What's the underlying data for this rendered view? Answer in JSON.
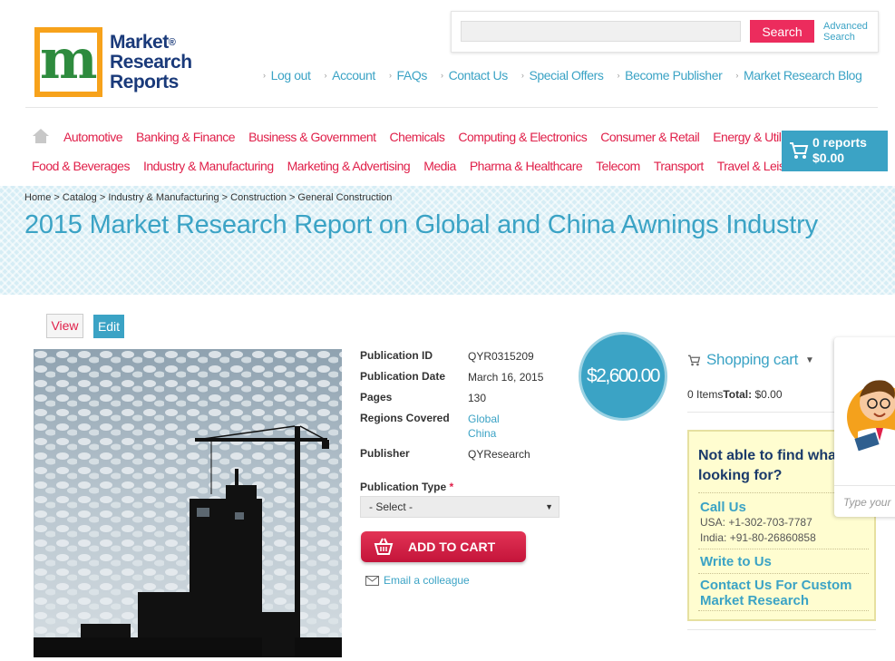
{
  "brand": {
    "logo_letter": "m",
    "line1": "Market",
    "line2": "Research",
    "line3": "Reports",
    "reg": "®"
  },
  "search": {
    "placeholder": "",
    "button": "Search",
    "advanced": "Advanced Search"
  },
  "top_links": [
    "Log out",
    "Account",
    "FAQs",
    "Contact Us",
    "Special Offers",
    "Become Publisher",
    "Market Research Blog"
  ],
  "nav_row1": [
    "Automotive",
    "Banking & Finance",
    "Business & Government",
    "Chemicals",
    "Computing & Electronics",
    "Consumer & Retail",
    "Energy & Utilities"
  ],
  "nav_row2": [
    "Food & Beverages",
    "Industry & Manufacturing",
    "Marketing & Advertising",
    "Media",
    "Pharma & Healthcare",
    "Telecom",
    "Transport",
    "Travel & Leisure"
  ],
  "cart_button": {
    "count": "0 reports",
    "total": "$0.00"
  },
  "breadcrumb": "Home > Catalog > Industry & Manufacturing > Construction > General Construction",
  "title": "2015 Market Research Report on Global and China Awnings Industry",
  "tabs": {
    "view": "View",
    "edit": "Edit"
  },
  "details": {
    "pub_id_label": "Publication ID",
    "pub_id": "QYR0315209",
    "pub_date_label": "Publication Date",
    "pub_date": "March 16, 2015",
    "pages_label": "Pages",
    "pages": "130",
    "regions_label": "Regions Covered",
    "region1": "Global",
    "region2": "China",
    "publisher_label": "Publisher",
    "publisher": "QYResearch"
  },
  "pub_type": {
    "label": "Publication Type",
    "required": "*",
    "selected": "- Select -"
  },
  "add_to_cart": "ADD TO CART",
  "email_colleague": "Email a colleague",
  "price": "$2,600.00",
  "shopping_cart": {
    "title": "Shopping cart",
    "items": "0 Items",
    "total_label": "Total:",
    "total": " $0.00"
  },
  "help": {
    "question": "Not able to find what you are looking for?",
    "call_us": "Call Us",
    "usa": "USA: +1-302-703-7787",
    "india": "India: +91-80-26860858",
    "write": "Write to Us",
    "custom": "Contact Us For Custom Market Research"
  },
  "chat": {
    "placeholder": "Type your"
  },
  "colors": {
    "accent": "#3ba3c5",
    "nav_red": "#e0204a",
    "search_btn": "#ec2c5d",
    "logo_orange": "#f7a21b"
  },
  "icons": [
    "home-icon",
    "cart-icon",
    "basket-icon",
    "envelope-icon",
    "chevron-down-icon"
  ]
}
